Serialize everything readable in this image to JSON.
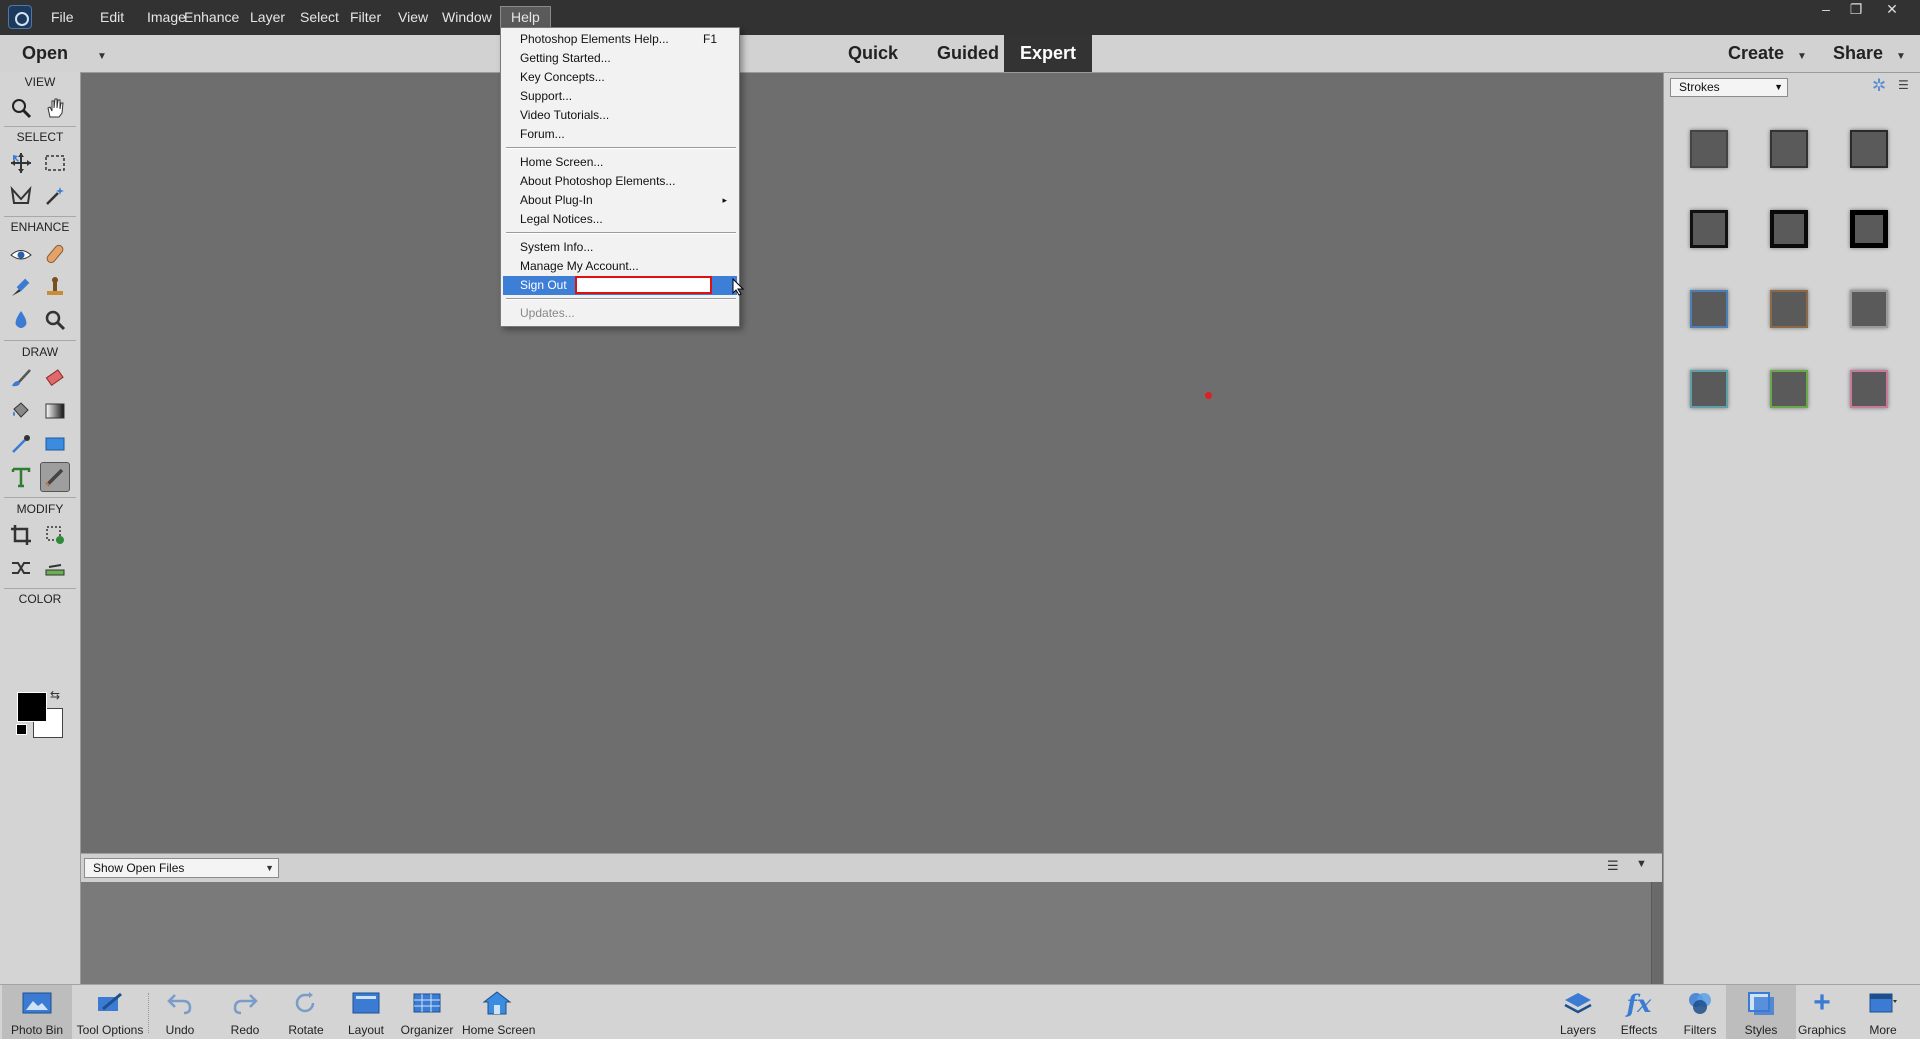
{
  "menubar": {
    "items": [
      "File",
      "Edit",
      "Image",
      "Enhance",
      "Layer",
      "Select",
      "Filter",
      "View",
      "Window",
      "Help"
    ],
    "active": "Help",
    "window_controls": [
      "–",
      "❐",
      "✕"
    ]
  },
  "modebar": {
    "open_label": "Open",
    "tabs": [
      "Quick",
      "Guided",
      "Expert"
    ],
    "active_tab": "Expert",
    "create_label": "Create",
    "share_label": "Share"
  },
  "toolbox": {
    "sections": [
      "VIEW",
      "SELECT",
      "ENHANCE",
      "DRAW",
      "MODIFY",
      "COLOR"
    ],
    "foreground_color": "#000000",
    "background_color": "#ffffff"
  },
  "help_menu": {
    "groups": [
      [
        {
          "label": "Photoshop Elements Help...",
          "shortcut": "F1"
        },
        {
          "label": "Getting Started..."
        },
        {
          "label": "Key Concepts..."
        },
        {
          "label": "Support..."
        },
        {
          "label": "Video Tutorials..."
        },
        {
          "label": "Forum..."
        }
      ],
      [
        {
          "label": "Home Screen..."
        },
        {
          "label": "About Photoshop Elements..."
        },
        {
          "label": "About Plug-In",
          "submenu": "▸"
        },
        {
          "label": "Legal Notices..."
        }
      ],
      [
        {
          "label": "System Info..."
        },
        {
          "label": "Manage My Account..."
        },
        {
          "label": "Sign Out",
          "highlighted": true
        }
      ],
      [
        {
          "label": "Updates...",
          "disabled": true
        }
      ]
    ]
  },
  "photo_bin": {
    "dropdown_value": "Show Open Files"
  },
  "right_panel": {
    "dropdown_value": "Strokes",
    "swatches": [
      {
        "style": "thin"
      },
      {
        "style": "thin"
      },
      {
        "style": "thin"
      },
      {
        "style": "medium"
      },
      {
        "style": "thick"
      },
      {
        "style": "thicker"
      },
      {
        "style": "blue"
      },
      {
        "style": "brown"
      },
      {
        "style": "gray"
      },
      {
        "style": "teal"
      },
      {
        "style": "green"
      },
      {
        "style": "pink"
      }
    ]
  },
  "taskbar": {
    "left": [
      "Photo Bin",
      "Tool Options",
      "Undo",
      "Redo",
      "Rotate",
      "Layout",
      "Organizer",
      "Home Screen"
    ],
    "right": [
      "Layers",
      "Effects",
      "Filters",
      "Styles",
      "Graphics",
      "More"
    ]
  },
  "colors": {
    "accent_highlight": "#3d7ed6",
    "redaction_border": "#e01010",
    "canvas": "#6e6e6e"
  }
}
